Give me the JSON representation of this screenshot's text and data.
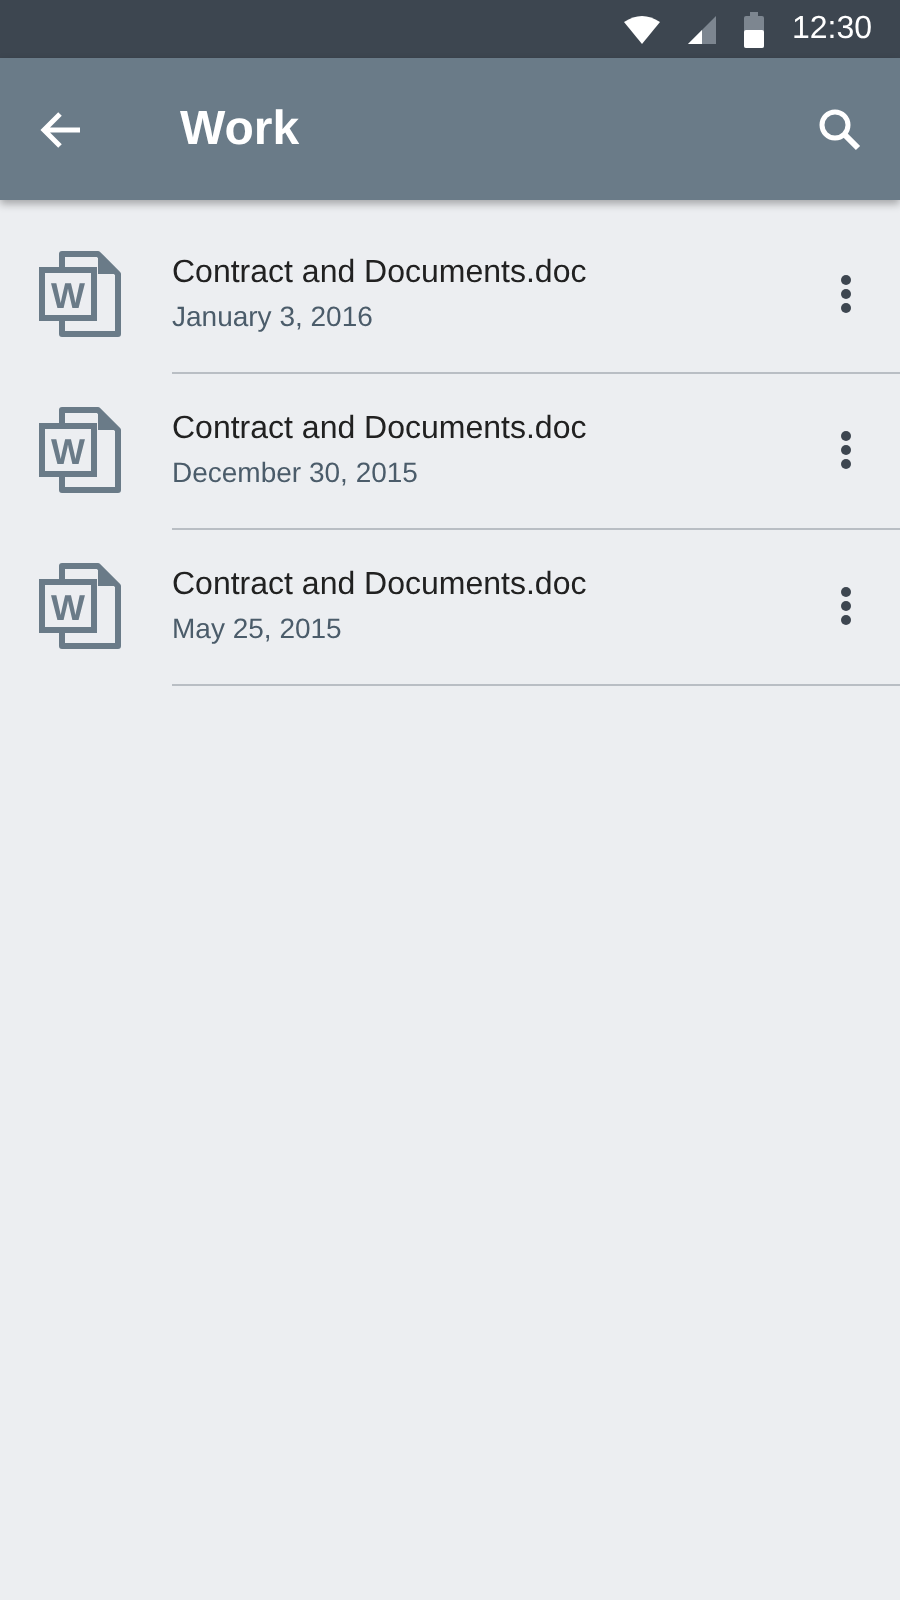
{
  "status_bar": {
    "time": "12:30"
  },
  "app_bar": {
    "title": "Work"
  },
  "files": [
    {
      "name": "Contract and Documents.doc",
      "date": "January 3, 2016",
      "icon_letter": "W"
    },
    {
      "name": "Contract and Documents.doc",
      "date": "December 30, 2015",
      "icon_letter": "W"
    },
    {
      "name": "Contract and Documents.doc",
      "date": "May 25, 2015",
      "icon_letter": "W"
    }
  ]
}
